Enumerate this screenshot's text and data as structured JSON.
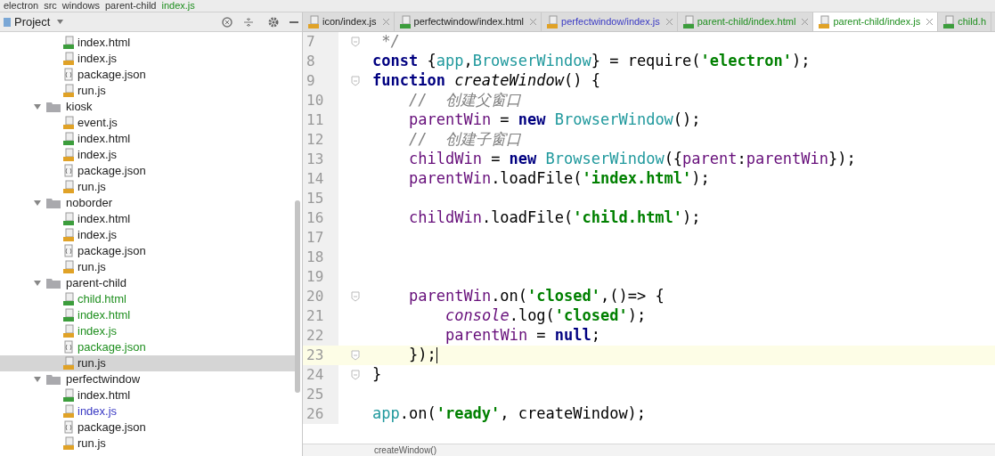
{
  "breadcrumb": [
    "electron",
    "src",
    "windows",
    "parent-child",
    "index.js"
  ],
  "project_panel": {
    "title": "Project"
  },
  "tree": [
    {
      "kind": "continuation",
      "children": [
        {
          "kind": "html",
          "name": "index.html",
          "selected": false
        },
        {
          "kind": "js",
          "name": "index.js",
          "selected": false
        },
        {
          "kind": "json",
          "name": "package.json",
          "selected": false
        },
        {
          "kind": "js",
          "name": "run.js",
          "selected": false
        }
      ]
    },
    {
      "kind": "folder",
      "name": "kiosk",
      "expanded": true,
      "children": [
        {
          "kind": "js",
          "name": "event.js",
          "selected": false
        },
        {
          "kind": "html",
          "name": "index.html",
          "selected": false
        },
        {
          "kind": "js",
          "name": "index.js",
          "selected": false
        },
        {
          "kind": "json",
          "name": "package.json",
          "selected": false
        },
        {
          "kind": "js",
          "name": "run.js",
          "selected": false
        }
      ]
    },
    {
      "kind": "folder",
      "name": "noborder",
      "expanded": true,
      "children": [
        {
          "kind": "html",
          "name": "index.html",
          "selected": false
        },
        {
          "kind": "js",
          "name": "index.js",
          "selected": false
        },
        {
          "kind": "json",
          "name": "package.json",
          "selected": false
        },
        {
          "kind": "js",
          "name": "run.js",
          "selected": false
        }
      ]
    },
    {
      "kind": "folder",
      "name": "parent-child",
      "expanded": true,
      "children": [
        {
          "kind": "html",
          "name": "child.html",
          "color": "#1f8f1f",
          "selected": false
        },
        {
          "kind": "html",
          "name": "index.html",
          "color": "#1f8f1f",
          "selected": false
        },
        {
          "kind": "js",
          "name": "index.js",
          "color": "#1f8f1f",
          "selected": false
        },
        {
          "kind": "json",
          "name": "package.json",
          "color": "#1f8f1f",
          "selected": false
        },
        {
          "kind": "js",
          "name": "run.js",
          "selected": true
        }
      ]
    },
    {
      "kind": "folder",
      "name": "perfectwindow",
      "expanded": true,
      "children": [
        {
          "kind": "html",
          "name": "index.html",
          "selected": false
        },
        {
          "kind": "js",
          "name": "index.js",
          "color": "#3a3ac4",
          "selected": false
        },
        {
          "kind": "json",
          "name": "package.json",
          "selected": false
        },
        {
          "kind": "js",
          "name": "run.js",
          "selected": false
        }
      ]
    }
  ],
  "tabs": [
    {
      "kind": "js",
      "label": "icon/index.js",
      "selected": false
    },
    {
      "kind": "html",
      "label": "perfectwindow/index.html",
      "selected": false
    },
    {
      "kind": "js",
      "label": "perfectwindow/index.js",
      "color": "#3a3ac4",
      "selected": false
    },
    {
      "kind": "html",
      "label": "parent-child/index.html",
      "color": "#1f8f1f",
      "selected": false
    },
    {
      "kind": "js",
      "label": "parent-child/index.js",
      "color": "#1f8f1f",
      "selected": true
    },
    {
      "kind": "html",
      "label": "child.h",
      "color": "#1f8f1f",
      "selected": false
    }
  ],
  "code_lines": [
    {
      "number": "7",
      "fold": true,
      "current": false,
      "tokens": [
        {
          "t": " */",
          "kind": "comment"
        }
      ]
    },
    {
      "number": "8",
      "fold": false,
      "current": false,
      "tokens": [
        {
          "t": "const ",
          "kind": "keyword"
        },
        {
          "t": "{",
          "kind": "plain"
        },
        {
          "t": "app",
          "kind": "class"
        },
        {
          "t": ",",
          "kind": "plain"
        },
        {
          "t": "BrowserWindow",
          "kind": "class"
        },
        {
          "t": "} = require(",
          "kind": "plain"
        },
        {
          "t": "'electron'",
          "kind": "string"
        },
        {
          "t": ");",
          "kind": "plain"
        }
      ]
    },
    {
      "number": "9",
      "fold": true,
      "current": false,
      "tokens": [
        {
          "t": "function ",
          "kind": "keyword"
        },
        {
          "t": "createWindow",
          "kind": "fn"
        },
        {
          "t": "() {",
          "kind": "plain"
        }
      ],
      "children": [
        {
          "number": "10",
          "fold": false,
          "current": false,
          "tokens": [
            {
              "t": "//  创建父窗口",
              "kind": "comment"
            }
          ]
        },
        {
          "number": "11",
          "fold": false,
          "current": false,
          "tokens": [
            {
              "t": "parentWin",
              "kind": "var"
            },
            {
              "t": " = ",
              "kind": "plain"
            },
            {
              "t": "new ",
              "kind": "keyword"
            },
            {
              "t": "BrowserWindow",
              "kind": "class"
            },
            {
              "t": "();",
              "kind": "plain"
            }
          ]
        },
        {
          "number": "12",
          "fold": false,
          "current": false,
          "tokens": [
            {
              "t": "//  创建子窗口",
              "kind": "comment"
            }
          ]
        },
        {
          "number": "13",
          "fold": false,
          "current": false,
          "tokens": [
            {
              "t": "childWin",
              "kind": "var"
            },
            {
              "t": " = ",
              "kind": "plain"
            },
            {
              "t": "new ",
              "kind": "keyword"
            },
            {
              "t": "BrowserWindow",
              "kind": "class"
            },
            {
              "t": "({",
              "kind": "plain"
            },
            {
              "t": "parent",
              "kind": "var"
            },
            {
              "t": ":",
              "kind": "plain"
            },
            {
              "t": "parentWin",
              "kind": "var"
            },
            {
              "t": "});",
              "kind": "plain"
            }
          ]
        },
        {
          "number": "14",
          "fold": false,
          "current": false,
          "tokens": [
            {
              "t": "parentWin",
              "kind": "var"
            },
            {
              "t": ".loadFile(",
              "kind": "plain"
            },
            {
              "t": "'index.html'",
              "kind": "string"
            },
            {
              "t": ");",
              "kind": "plain"
            }
          ]
        },
        {
          "number": "15",
          "fold": false,
          "current": false
        },
        {
          "number": "16",
          "fold": false,
          "current": false,
          "tokens": [
            {
              "t": "childWin",
              "kind": "var"
            },
            {
              "t": ".loadFile(",
              "kind": "plain"
            },
            {
              "t": "'child.html'",
              "kind": "string"
            },
            {
              "t": ");",
              "kind": "plain"
            }
          ]
        },
        {
          "number": "17",
          "fold": false,
          "current": false
        },
        {
          "number": "18",
          "fold": false,
          "current": false
        },
        {
          "number": "19",
          "fold": false,
          "current": false
        },
        {
          "number": "20",
          "fold": true,
          "current": false,
          "tokens": [
            {
              "t": "parentWin",
              "kind": "var"
            },
            {
              "t": ".on(",
              "kind": "plain"
            },
            {
              "t": "'closed'",
              "kind": "string"
            },
            {
              "t": ",()=> {",
              "kind": "plain"
            }
          ],
          "children": [
            {
              "number": "21",
              "fold": false,
              "current": false,
              "tokens": [
                {
                  "t": "console",
                  "kind": "global"
                },
                {
                  "t": ".log(",
                  "kind": "plain"
                },
                {
                  "t": "'closed'",
                  "kind": "string"
                },
                {
                  "t": ");",
                  "kind": "plain"
                }
              ]
            },
            {
              "number": "22",
              "fold": false,
              "current": false,
              "tokens": [
                {
                  "t": "parentWin",
                  "kind": "var"
                },
                {
                  "t": " = ",
                  "kind": "plain"
                },
                {
                  "t": "null",
                  "kind": "keyword"
                },
                {
                  "t": ";",
                  "kind": "plain"
                }
              ]
            }
          ]
        },
        {
          "number": "23",
          "fold": true,
          "current": true,
          "tokens": [
            {
              "t": "});",
              "kind": "plain"
            }
          ]
        }
      ]
    },
    {
      "number": "24",
      "fold": true,
      "current": false,
      "tokens": [
        {
          "t": "}",
          "kind": "plain"
        }
      ]
    },
    {
      "number": "25",
      "fold": false,
      "current": false
    },
    {
      "number": "26",
      "fold": false,
      "current": false,
      "tokens": [
        {
          "t": "app",
          "kind": "class"
        },
        {
          "t": ".on(",
          "kind": "plain"
        },
        {
          "t": "'ready'",
          "kind": "string"
        },
        {
          "t": ", createWindow);",
          "kind": "plain"
        }
      ]
    }
  ],
  "status_bar": {
    "scope": "createWindow()"
  }
}
